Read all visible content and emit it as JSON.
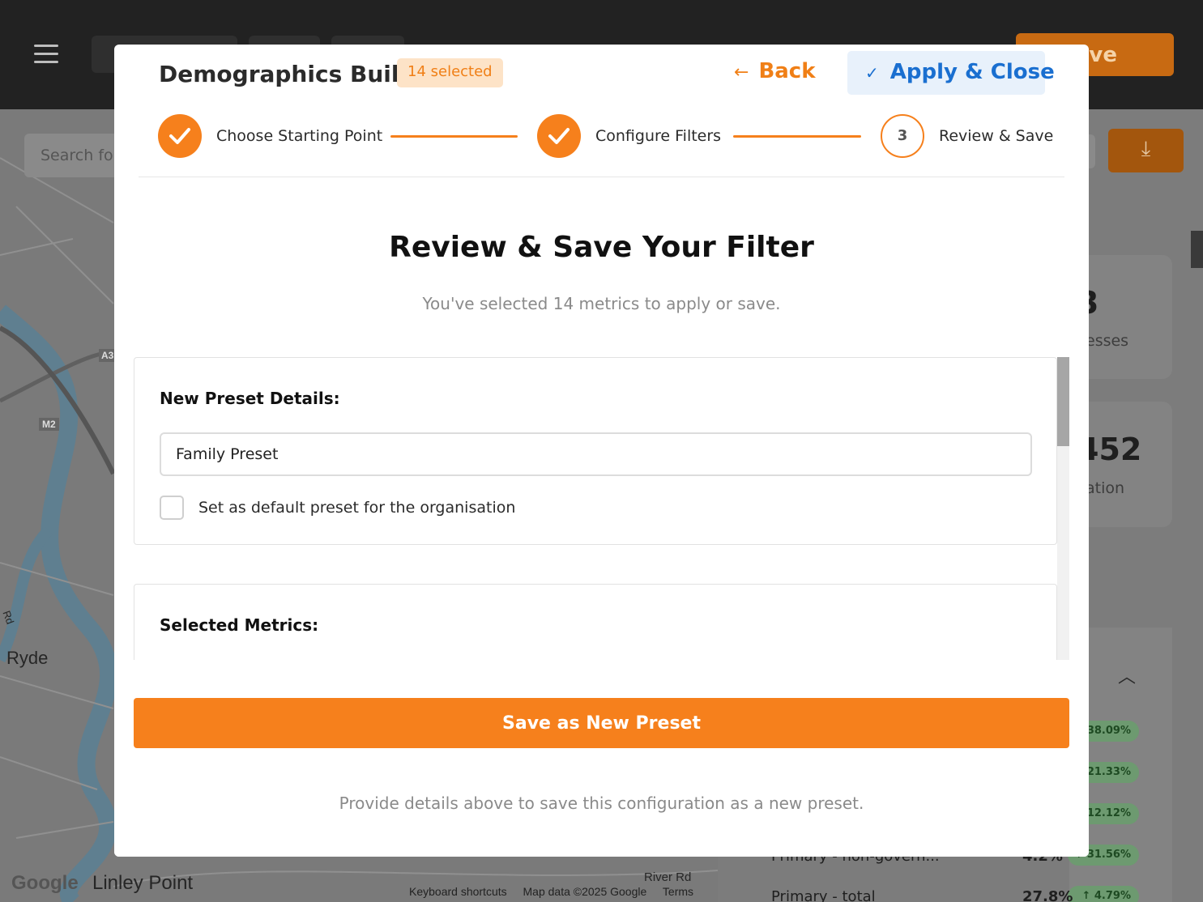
{
  "background": {
    "top_save_label": "ave",
    "map_search_placeholder": "Search for",
    "map_labels": {
      "ryde": "Ryde",
      "linley_point": "Linley Point",
      "river_rd": "River Rd",
      "m2": "M2",
      "a3": "A3",
      "rd": "Rd",
      "google": "Google"
    },
    "map_footer": {
      "shortcuts": "Keyboard shortcuts",
      "map_data": "Map data ©2025 Google",
      "terms": "Terms"
    },
    "stat_cards": [
      {
        "value": "3",
        "label": "esses"
      },
      {
        "value": "452",
        "label": "ation"
      }
    ],
    "list_rows": [
      {
        "label": "",
        "value": "",
        "change": "38.09%"
      },
      {
        "label": "",
        "value": "",
        "change": "21.33%"
      },
      {
        "label": "",
        "value": "",
        "change": "12.12%"
      },
      {
        "label": "Primary - non-govern...",
        "value": "4.2%",
        "change": "↑ 31.56%"
      },
      {
        "label": "Primary - total",
        "value": "27.8%",
        "change": "↑ 4.79%"
      }
    ]
  },
  "modal": {
    "title": "Demographics Builder",
    "selected_badge": "14 selected",
    "back_label": "Back",
    "apply_label": "Apply & Close",
    "steps": [
      {
        "label": "Choose Starting Point",
        "status": "done"
      },
      {
        "label": "Configure Filters",
        "status": "done"
      },
      {
        "number": "3",
        "label": "Review & Save",
        "status": "current"
      }
    ],
    "review_title": "Review & Save Your Filter",
    "review_subtitle": "You've selected 14 metrics to apply or save.",
    "preset_section": {
      "heading": "New Preset Details:",
      "name_value": "Family Preset",
      "default_checkbox_label": "Set as default preset for the organisation",
      "default_checked": false
    },
    "metrics_section": {
      "heading": "Selected Metrics:"
    },
    "save_button_label": "Save as New Preset",
    "hint": "Provide details above to save this configuration as a new preset."
  },
  "colors": {
    "accent": "#f6801c",
    "apply_blue": "#1a6fd0",
    "apply_bg": "#e8f1fb",
    "badge_bg": "#fde3c7"
  }
}
